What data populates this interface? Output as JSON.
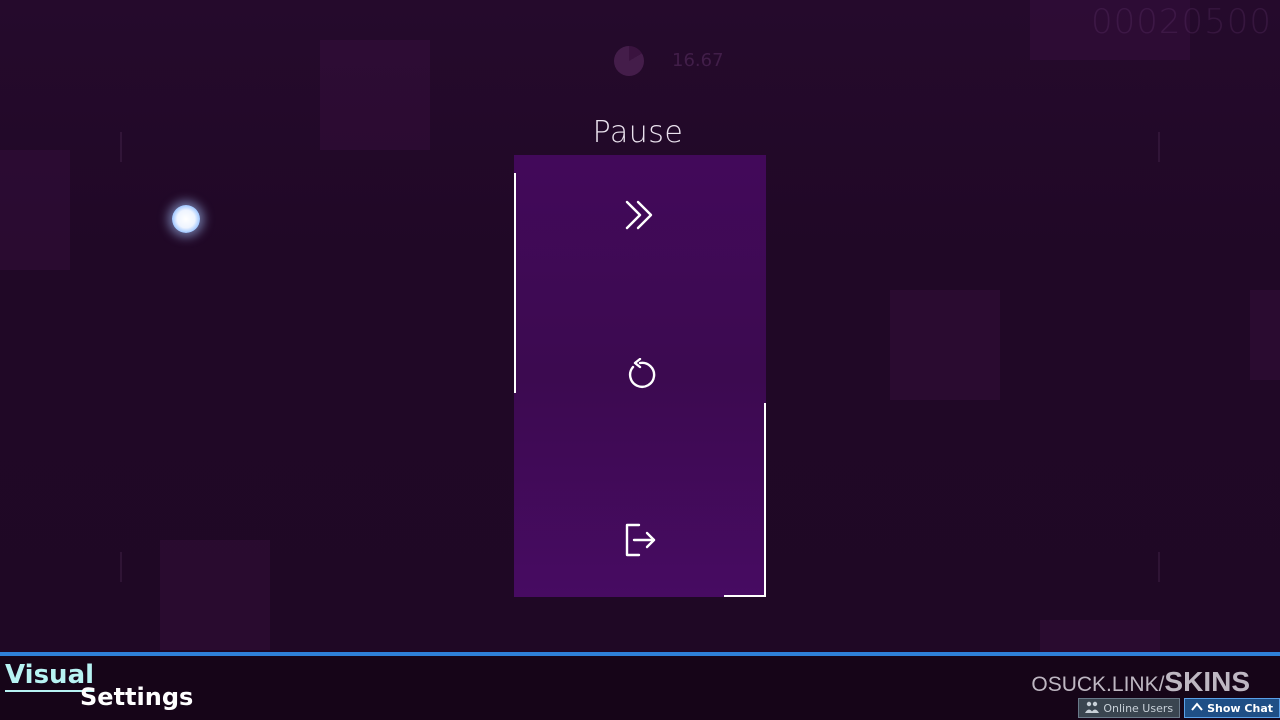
{
  "hud": {
    "score": "00020500",
    "accuracy": "16.67"
  },
  "pause_menu": {
    "title": "Pause",
    "buttons": [
      {
        "action": "continue",
        "icon": "double-chevron-right-icon"
      },
      {
        "action": "retry",
        "icon": "retry-icon"
      },
      {
        "action": "quit",
        "icon": "exit-icon"
      }
    ]
  },
  "footer": {
    "visual_label": "Visual",
    "settings_label": "Settings",
    "brand_prefix": "OSUCK.LINK/",
    "brand_suffix": "SKINS",
    "online_users_label": "Online Users",
    "show_chat_label": "Show Chat"
  },
  "colors": {
    "panel": "#42095a",
    "accent_bar": "#2f80d8",
    "visual_text": "#b7f3f3"
  }
}
